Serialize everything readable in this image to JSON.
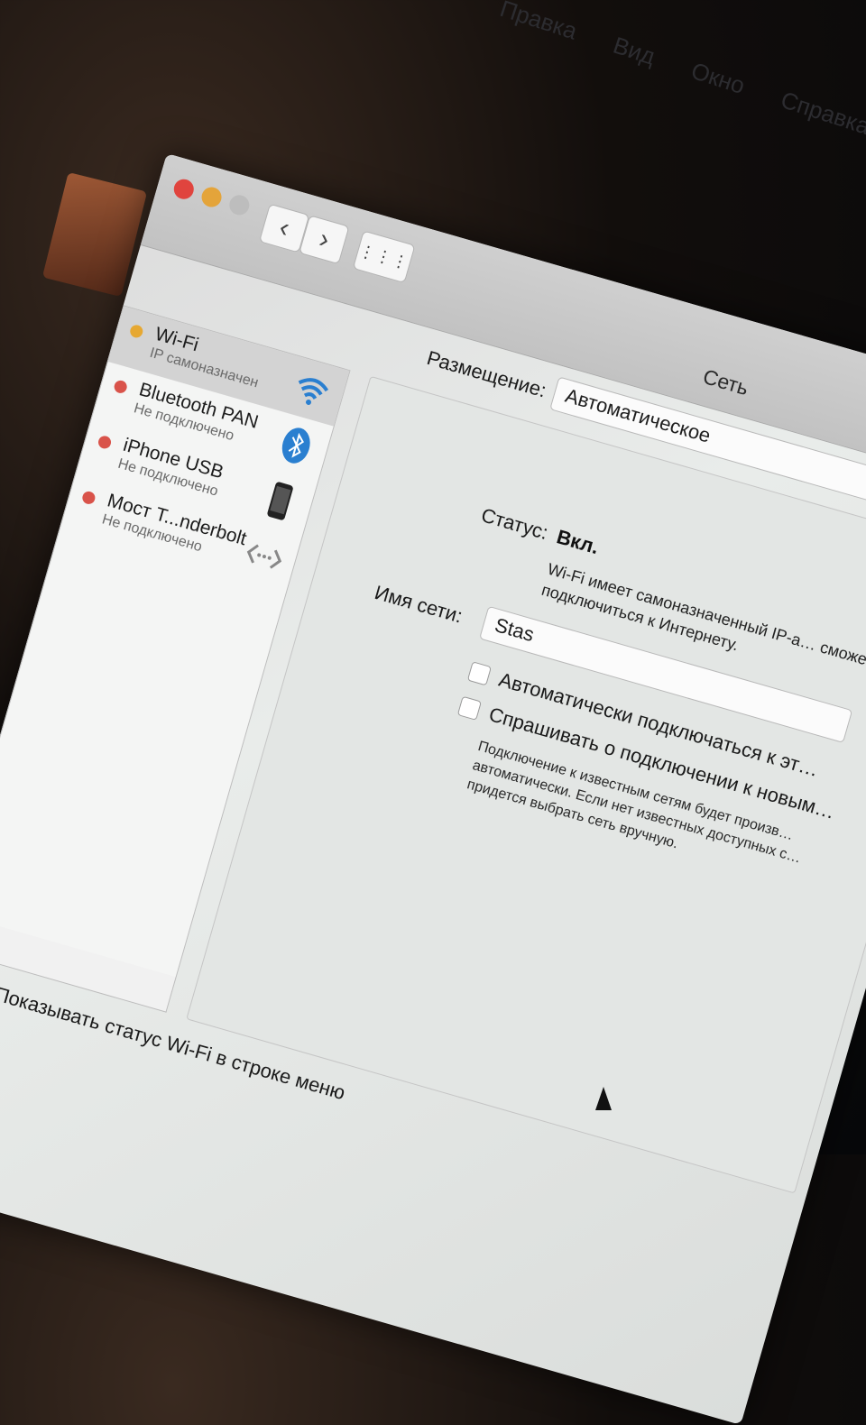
{
  "menubar": {
    "items": [
      "Правка",
      "Вид",
      "Окно",
      "Справка"
    ]
  },
  "window": {
    "title": "Сеть",
    "nav": {
      "back_icon": "‹",
      "forward_icon": "›",
      "grid_icon": "⋮⋮⋮"
    }
  },
  "location": {
    "label": "Размещение:",
    "value": "Автоматическое"
  },
  "sidebar": {
    "services": [
      {
        "name": "Wi-Fi",
        "status": "IP самоназначен",
        "dot_color": "#e6a832",
        "icon": "wifi-icon",
        "selected": true
      },
      {
        "name": "Bluetooth PAN",
        "status": "Не подключено",
        "dot_color": "#d9534a",
        "icon": "bluetooth-icon",
        "selected": false
      },
      {
        "name": "iPhone USB",
        "status": "Не подключено",
        "dot_color": "#d9534a",
        "icon": "iphone-icon",
        "selected": false
      },
      {
        "name": "Мост T...nderbolt",
        "status": "Не подключено",
        "dot_color": "#d9534a",
        "icon": "thunderbolt-bridge-icon",
        "selected": false
      }
    ]
  },
  "pane": {
    "status_label": "Статус:",
    "status_value": "Вкл.",
    "status_desc": "Wi-Fi имеет самоназначенный IP-а… сможет подключиться к Интернету.",
    "network_label": "Имя сети:",
    "network_value": "Stas",
    "auto_join_label": "Автоматически подключаться к эт…",
    "ask_join_label": "Спрашивать о подключении к новым…",
    "hint": "Подключение к известным сетям будет произв… автоматически. Если нет известных доступных с… придется выбрать сеть вручную."
  },
  "footer": {
    "show_wifi_label": "Показывать статус Wi-Fi в строке меню",
    "show_wifi_checked": true
  }
}
